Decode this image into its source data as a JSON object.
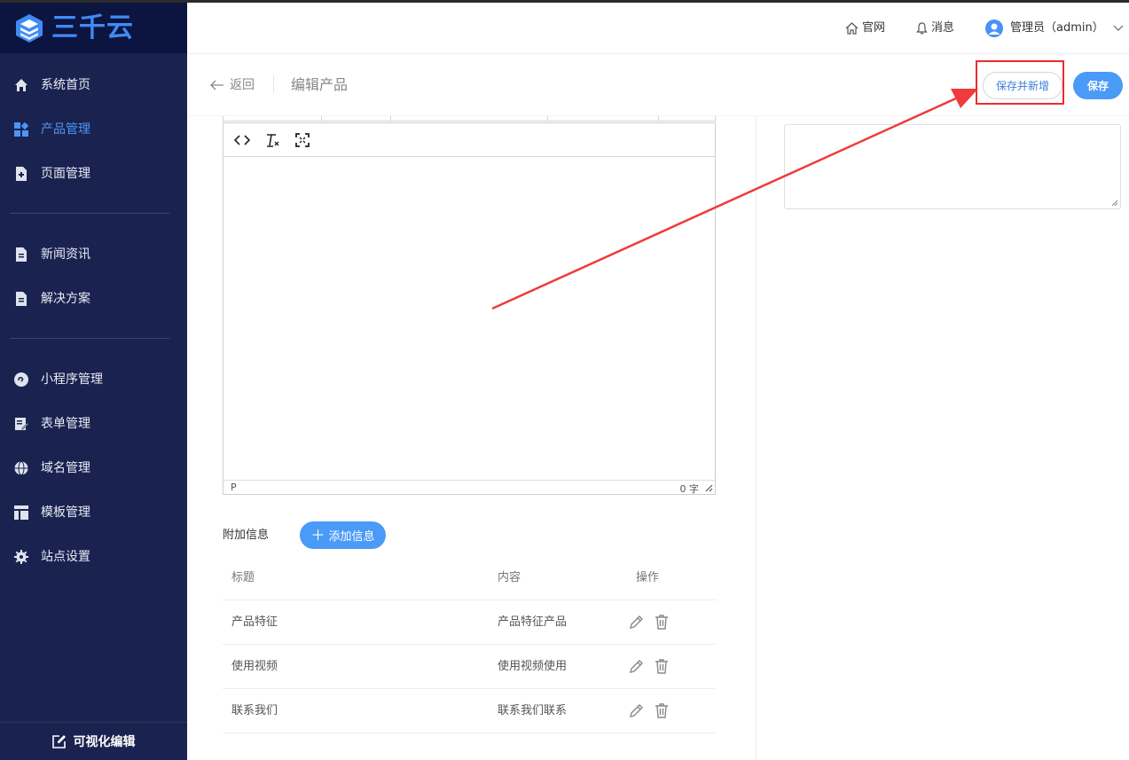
{
  "brand": {
    "name": "三千云",
    "color": "#3f8bf5"
  },
  "sidebar": {
    "items": [
      {
        "label": "系统首页",
        "icon": "home-icon"
      },
      {
        "label": "产品管理",
        "icon": "grid-icon",
        "active": true
      },
      {
        "label": "页面管理",
        "icon": "page-add-icon"
      },
      {
        "label": "新闻资讯",
        "icon": "document-icon"
      },
      {
        "label": "解决方案",
        "icon": "document-icon"
      },
      {
        "label": "小程序管理",
        "icon": "mini-program-icon"
      },
      {
        "label": "表单管理",
        "icon": "form-edit-icon"
      },
      {
        "label": "域名管理",
        "icon": "globe-icon"
      },
      {
        "label": "模板管理",
        "icon": "template-icon"
      },
      {
        "label": "站点设置",
        "icon": "gear-icon"
      }
    ],
    "visual_edit": "可视化编辑"
  },
  "header": {
    "website": "官网",
    "messages": "消息",
    "user": "管理员（admin）"
  },
  "subheader": {
    "back": "返回",
    "title": "编辑产品",
    "save_new": "保存并新增",
    "save": "保存"
  },
  "editor": {
    "status_tag": "P",
    "word_count": "0 字"
  },
  "extra": {
    "label": "附加信息",
    "add_button": "添加信息",
    "columns": [
      "标题",
      "内容",
      "操作"
    ],
    "rows": [
      {
        "title": "产品特征",
        "content": "产品特征产品"
      },
      {
        "title": "使用视频",
        "content": "使用视频使用"
      },
      {
        "title": "联系我们",
        "content": "联系我们联系"
      }
    ]
  },
  "colors": {
    "sidebar_bg": "#1a2350",
    "primary": "#4a9af7",
    "annotation": "#ee2b2b"
  }
}
